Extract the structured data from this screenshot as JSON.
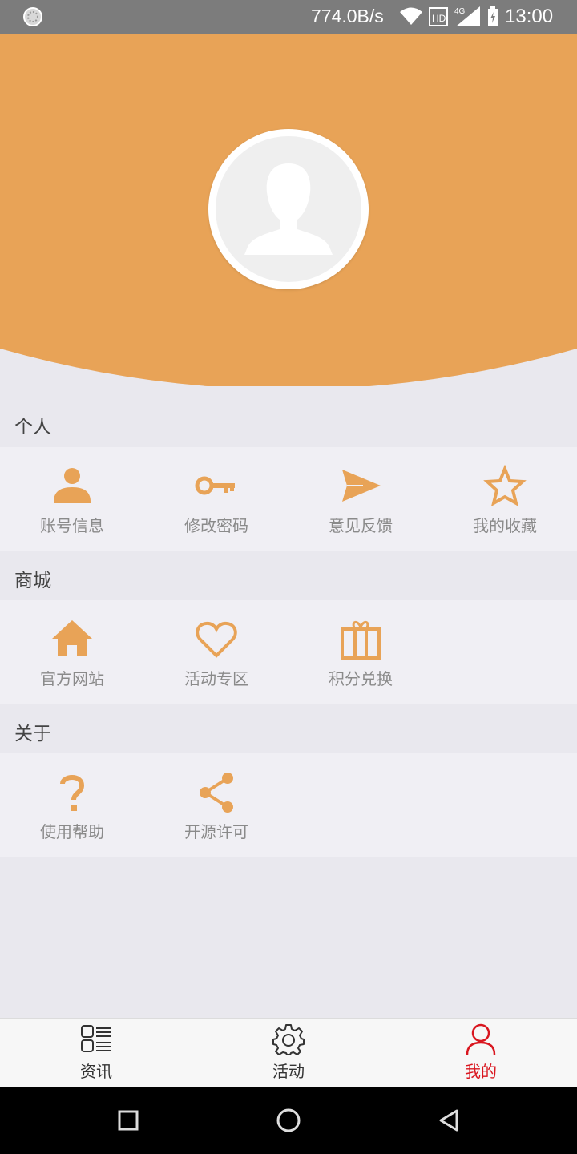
{
  "status_bar": {
    "speed": "774.0B/s",
    "network": "4G",
    "time": "13:00",
    "hd_badge": "HD"
  },
  "colors": {
    "accent": "#e8a357",
    "active_tab": "#d9161f",
    "background": "#e9e8ee",
    "grid_background": "#f0eff4"
  },
  "profile": {
    "avatar_icon": "user-silhouette-icon"
  },
  "sections": [
    {
      "title": "个人",
      "items": [
        {
          "label": "账号信息",
          "icon": "person-icon"
        },
        {
          "label": "修改密码",
          "icon": "key-icon"
        },
        {
          "label": "意见反馈",
          "icon": "send-icon"
        },
        {
          "label": "我的收藏",
          "icon": "star-icon"
        }
      ]
    },
    {
      "title": "商城",
      "items": [
        {
          "label": "官方网站",
          "icon": "home-icon"
        },
        {
          "label": "活动专区",
          "icon": "heart-icon"
        },
        {
          "label": "积分兑换",
          "icon": "gift-icon"
        }
      ]
    },
    {
      "title": "关于",
      "items": [
        {
          "label": "使用帮助",
          "icon": "question-icon"
        },
        {
          "label": "开源许可",
          "icon": "share-icon"
        }
      ]
    }
  ],
  "bottom_nav": [
    {
      "label": "资讯",
      "icon": "news-list-icon"
    },
    {
      "label": "活动",
      "icon": "gear-icon"
    },
    {
      "label": "我的",
      "icon": "user-icon",
      "active": true
    }
  ]
}
